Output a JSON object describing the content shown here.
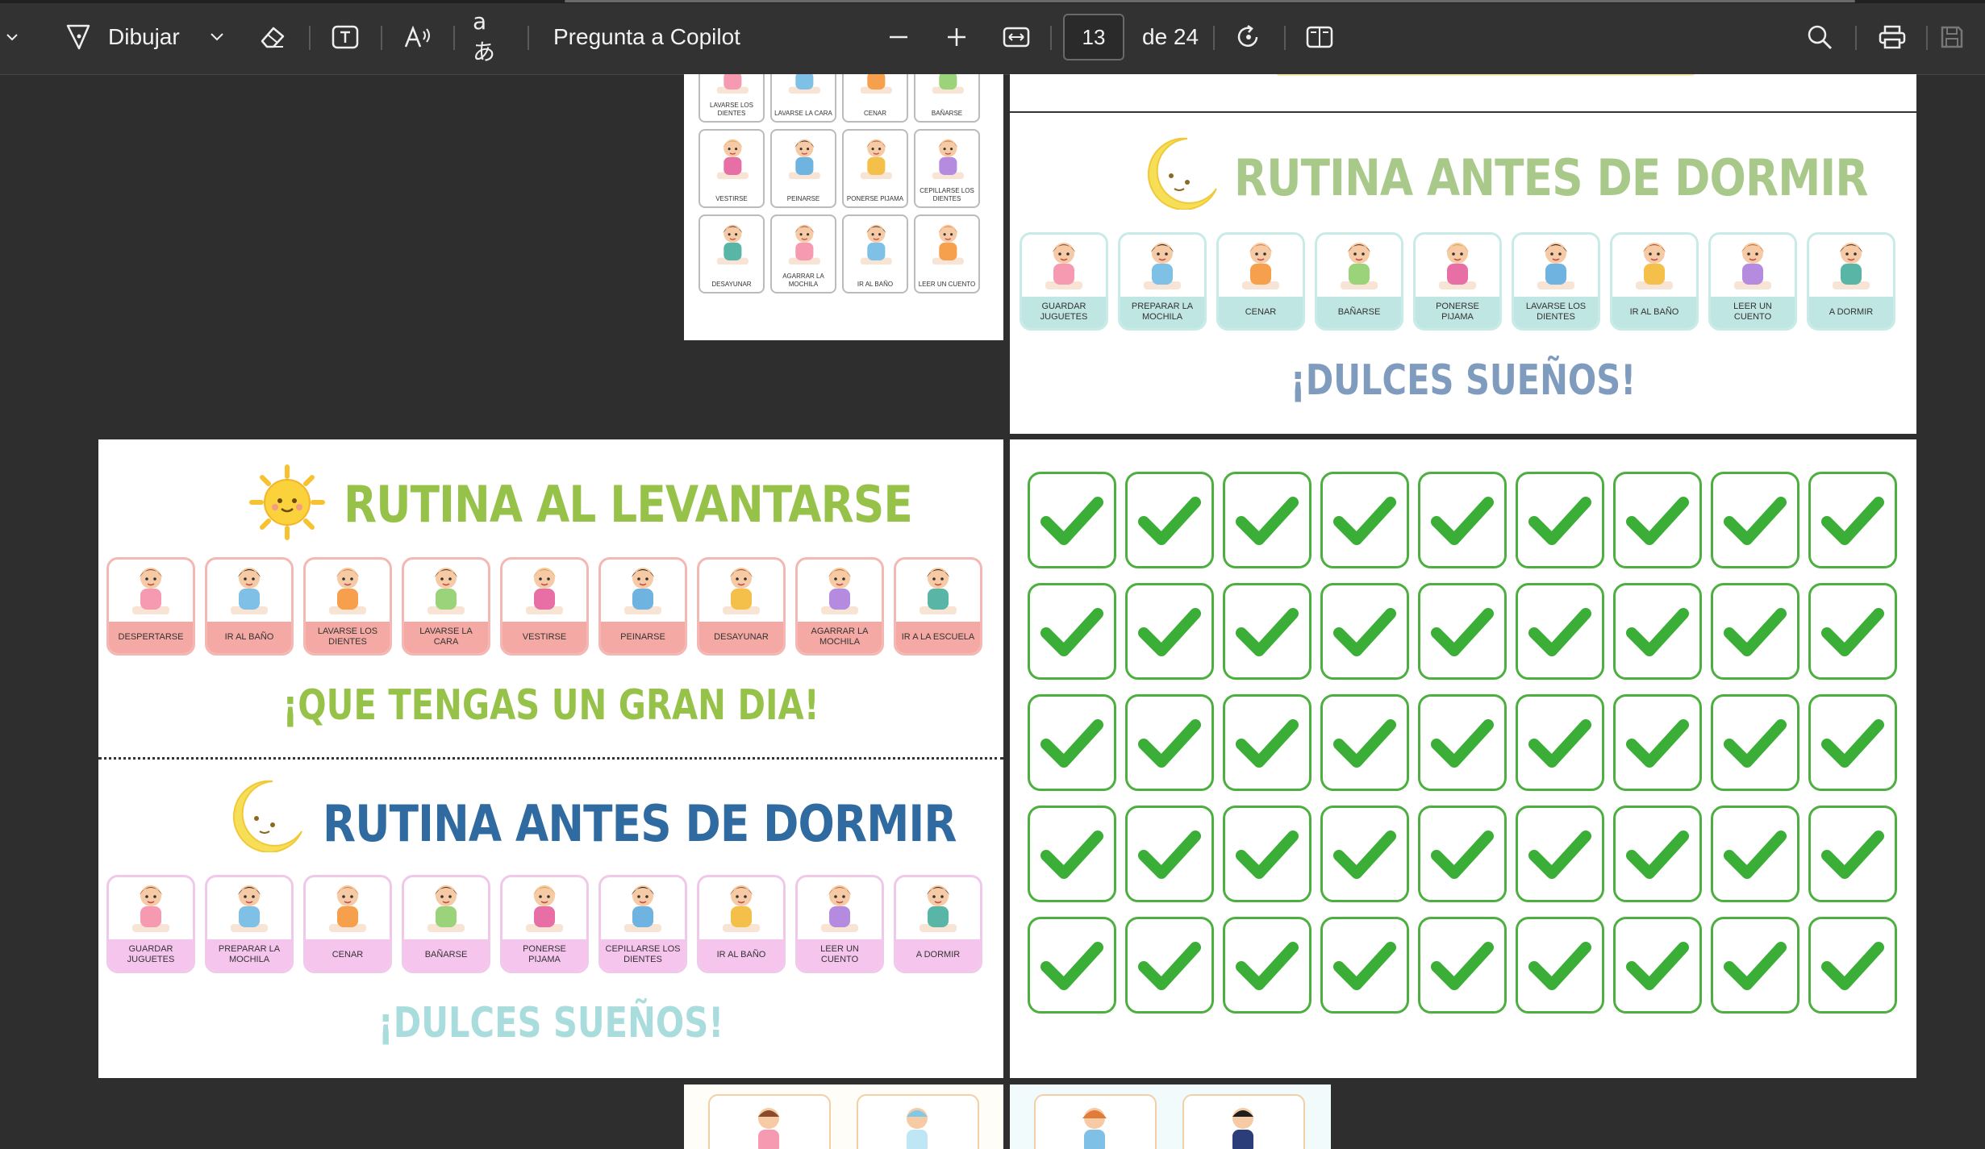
{
  "toolbar": {
    "draw_label": "Dibujar",
    "copilot_label": "Pregunta a Copilot",
    "page_current": "13",
    "page_total_label": "de 24",
    "icons": [
      "chevron-left-icon",
      "draw-pen-icon",
      "chevron-down-icon",
      "eraser-icon",
      "text-box-icon",
      "read-aloud-icon",
      "translate-icon",
      "zoom-out-icon",
      "zoom-in-icon",
      "fit-width-icon",
      "rotate-icon",
      "two-page-view-icon",
      "search-icon",
      "print-icon",
      "save-icon"
    ]
  },
  "page_top_left": {
    "rows": [
      [
        "LAVARSE LOS DIENTES",
        "LAVARSE LA CARA",
        "CENAR",
        "BAÑARSE"
      ],
      [
        "VESTIRSE",
        "PEINARSE",
        "PONERSE PIJAMA",
        "CEPILLARSE LOS DIENTES"
      ],
      [
        "DESAYUNAR",
        "AGARRAR LA MOCHILA",
        "IR AL BAÑO",
        "LEER UN CUENTO"
      ]
    ]
  },
  "page_top_right": {
    "title": "RUTINA ANTES DE DORMIR",
    "cards": [
      "GUARDAR JUGUETES",
      "PREPARAR LA MOCHILA",
      "CENAR",
      "BAÑARSE",
      "PONERSE PIJAMA",
      "LAVARSE LOS DIENTES",
      "IR AL BAÑO",
      "LEER UN CUENTO",
      "A DORMIR"
    ],
    "slogan": "¡DULCES SUEÑOS!",
    "colors": {
      "title": "#a9c98a",
      "card_caption_bg": "#bfe6e2",
      "slogan": "#7f9cbf"
    }
  },
  "page_main_left": {
    "morning": {
      "title": "RUTINA AL LEVANTARSE",
      "cards": [
        "DESPERTARSE",
        "IR AL BAÑO",
        "LAVARSE LOS DIENTES",
        "LAVARSE LA CARA",
        "VESTIRSE",
        "PEINARSE",
        "DESAYUNAR",
        "AGARRAR LA MOCHILA",
        "IR A LA ESCUELA"
      ],
      "slogan": "¡QUE TENGAS UN GRAN DIA!",
      "colors": {
        "title": "#97c24a",
        "card_caption_bg": "#f5a9a4",
        "card_border": "#f4b8b4",
        "slogan": "#97c24a"
      }
    },
    "night": {
      "title": "RUTINA ANTES DE DORMIR",
      "cards": [
        "GUARDAR JUGUETES",
        "PREPARAR LA MOCHILA",
        "CENAR",
        "BAÑARSE",
        "PONERSE PIJAMA",
        "CEPILLARSE LOS DIENTES",
        "IR AL BAÑO",
        "LEER UN CUENTO",
        "A DORMIR"
      ],
      "slogan": "¡DULCES SUEÑOS!",
      "colors": {
        "title": "#2f6aa0",
        "card_caption_bg": "#f6c5ee",
        "card_border": "#f0c8ea",
        "slogan": "#a9dcdc"
      }
    }
  },
  "page_main_right": {
    "check_rows": 5,
    "check_cols": 9,
    "colors": {
      "check": "#3aae36",
      "border": "#4caf3f"
    }
  }
}
